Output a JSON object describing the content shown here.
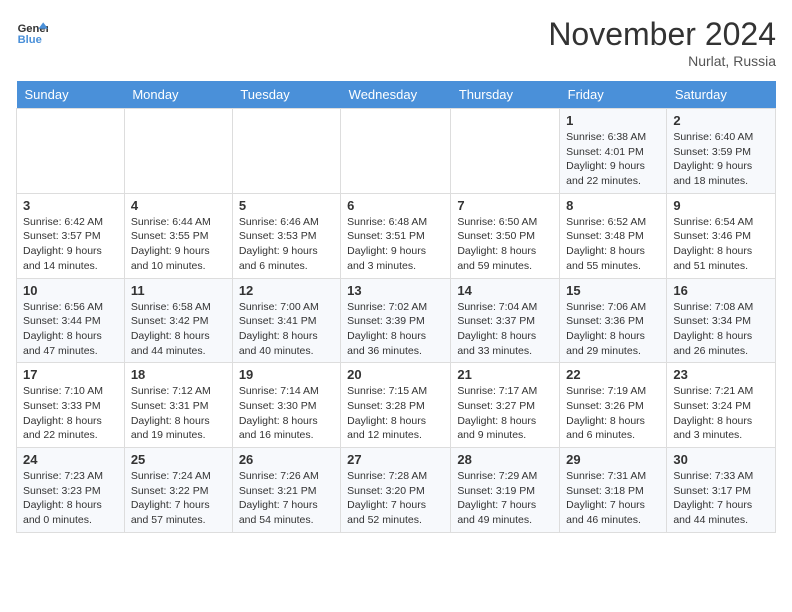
{
  "header": {
    "logo_line1": "General",
    "logo_line2": "Blue",
    "month": "November 2024",
    "location": "Nurlat, Russia"
  },
  "weekdays": [
    "Sunday",
    "Monday",
    "Tuesday",
    "Wednesday",
    "Thursday",
    "Friday",
    "Saturday"
  ],
  "weeks": [
    [
      {
        "day": "",
        "info": ""
      },
      {
        "day": "",
        "info": ""
      },
      {
        "day": "",
        "info": ""
      },
      {
        "day": "",
        "info": ""
      },
      {
        "day": "",
        "info": ""
      },
      {
        "day": "1",
        "info": "Sunrise: 6:38 AM\nSunset: 4:01 PM\nDaylight: 9 hours and 22 minutes."
      },
      {
        "day": "2",
        "info": "Sunrise: 6:40 AM\nSunset: 3:59 PM\nDaylight: 9 hours and 18 minutes."
      }
    ],
    [
      {
        "day": "3",
        "info": "Sunrise: 6:42 AM\nSunset: 3:57 PM\nDaylight: 9 hours and 14 minutes."
      },
      {
        "day": "4",
        "info": "Sunrise: 6:44 AM\nSunset: 3:55 PM\nDaylight: 9 hours and 10 minutes."
      },
      {
        "day": "5",
        "info": "Sunrise: 6:46 AM\nSunset: 3:53 PM\nDaylight: 9 hours and 6 minutes."
      },
      {
        "day": "6",
        "info": "Sunrise: 6:48 AM\nSunset: 3:51 PM\nDaylight: 9 hours and 3 minutes."
      },
      {
        "day": "7",
        "info": "Sunrise: 6:50 AM\nSunset: 3:50 PM\nDaylight: 8 hours and 59 minutes."
      },
      {
        "day": "8",
        "info": "Sunrise: 6:52 AM\nSunset: 3:48 PM\nDaylight: 8 hours and 55 minutes."
      },
      {
        "day": "9",
        "info": "Sunrise: 6:54 AM\nSunset: 3:46 PM\nDaylight: 8 hours and 51 minutes."
      }
    ],
    [
      {
        "day": "10",
        "info": "Sunrise: 6:56 AM\nSunset: 3:44 PM\nDaylight: 8 hours and 47 minutes."
      },
      {
        "day": "11",
        "info": "Sunrise: 6:58 AM\nSunset: 3:42 PM\nDaylight: 8 hours and 44 minutes."
      },
      {
        "day": "12",
        "info": "Sunrise: 7:00 AM\nSunset: 3:41 PM\nDaylight: 8 hours and 40 minutes."
      },
      {
        "day": "13",
        "info": "Sunrise: 7:02 AM\nSunset: 3:39 PM\nDaylight: 8 hours and 36 minutes."
      },
      {
        "day": "14",
        "info": "Sunrise: 7:04 AM\nSunset: 3:37 PM\nDaylight: 8 hours and 33 minutes."
      },
      {
        "day": "15",
        "info": "Sunrise: 7:06 AM\nSunset: 3:36 PM\nDaylight: 8 hours and 29 minutes."
      },
      {
        "day": "16",
        "info": "Sunrise: 7:08 AM\nSunset: 3:34 PM\nDaylight: 8 hours and 26 minutes."
      }
    ],
    [
      {
        "day": "17",
        "info": "Sunrise: 7:10 AM\nSunset: 3:33 PM\nDaylight: 8 hours and 22 minutes."
      },
      {
        "day": "18",
        "info": "Sunrise: 7:12 AM\nSunset: 3:31 PM\nDaylight: 8 hours and 19 minutes."
      },
      {
        "day": "19",
        "info": "Sunrise: 7:14 AM\nSunset: 3:30 PM\nDaylight: 8 hours and 16 minutes."
      },
      {
        "day": "20",
        "info": "Sunrise: 7:15 AM\nSunset: 3:28 PM\nDaylight: 8 hours and 12 minutes."
      },
      {
        "day": "21",
        "info": "Sunrise: 7:17 AM\nSunset: 3:27 PM\nDaylight: 8 hours and 9 minutes."
      },
      {
        "day": "22",
        "info": "Sunrise: 7:19 AM\nSunset: 3:26 PM\nDaylight: 8 hours and 6 minutes."
      },
      {
        "day": "23",
        "info": "Sunrise: 7:21 AM\nSunset: 3:24 PM\nDaylight: 8 hours and 3 minutes."
      }
    ],
    [
      {
        "day": "24",
        "info": "Sunrise: 7:23 AM\nSunset: 3:23 PM\nDaylight: 8 hours and 0 minutes."
      },
      {
        "day": "25",
        "info": "Sunrise: 7:24 AM\nSunset: 3:22 PM\nDaylight: 7 hours and 57 minutes."
      },
      {
        "day": "26",
        "info": "Sunrise: 7:26 AM\nSunset: 3:21 PM\nDaylight: 7 hours and 54 minutes."
      },
      {
        "day": "27",
        "info": "Sunrise: 7:28 AM\nSunset: 3:20 PM\nDaylight: 7 hours and 52 minutes."
      },
      {
        "day": "28",
        "info": "Sunrise: 7:29 AM\nSunset: 3:19 PM\nDaylight: 7 hours and 49 minutes."
      },
      {
        "day": "29",
        "info": "Sunrise: 7:31 AM\nSunset: 3:18 PM\nDaylight: 7 hours and 46 minutes."
      },
      {
        "day": "30",
        "info": "Sunrise: 7:33 AM\nSunset: 3:17 PM\nDaylight: 7 hours and 44 minutes."
      }
    ]
  ]
}
